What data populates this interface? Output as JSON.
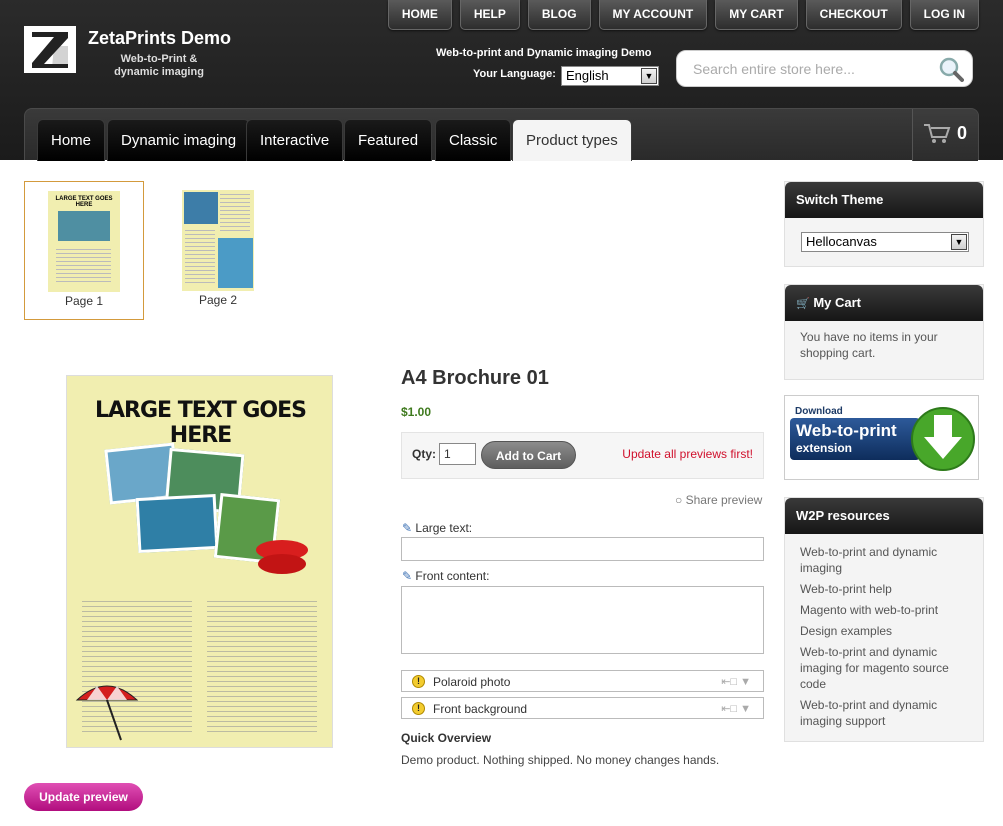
{
  "header": {
    "logo_title": "ZetaPrints Demo",
    "logo_subtitle": "Web-to-Print & dynamic imaging",
    "tagline": "Web-to-print and Dynamic imaging Demo",
    "language_label": "Your Language:",
    "language_value": "English",
    "search_placeholder": "Search entire store here...",
    "top_links": [
      "HOME",
      "HELP",
      "BLOG",
      "MY ACCOUNT",
      "MY CART",
      "CHECKOUT",
      "LOG IN"
    ],
    "tabs": [
      "Home",
      "Dynamic imaging",
      "Interactive",
      "Featured",
      "Classic",
      "Product types"
    ],
    "active_tab": "Product types",
    "cart_count": "0"
  },
  "pages": [
    {
      "label": "Page 1",
      "selected": true
    },
    {
      "label": "Page 2",
      "selected": false
    }
  ],
  "preview": {
    "headline": "LARGE TEXT GOES HERE"
  },
  "product": {
    "title": "A4 Brochure 01",
    "price": "$1.00",
    "qty_label": "Qty:",
    "qty_value": "1",
    "add_to_cart": "Add to Cart",
    "update_note": "Update all previews first!",
    "share": "Share preview",
    "fields": [
      {
        "label": "Large text:",
        "value": ""
      },
      {
        "label": "Front content:",
        "value": ""
      }
    ],
    "images": [
      {
        "label": "Polaroid photo"
      },
      {
        "label": "Front background"
      }
    ],
    "quick_overview_title": "Quick Overview",
    "quick_overview_text": "Demo product. Nothing shipped. No money changes hands.",
    "update_preview": "Update preview"
  },
  "sidebar": {
    "switch_theme_title": "Switch Theme",
    "theme_value": "Hellocanvas",
    "cart_title": "My Cart",
    "cart_text": "You have no items in your shopping cart.",
    "banner_download": "Download",
    "banner_line1": "Web-to-print",
    "banner_line2": "extension",
    "resources_title": "W2P resources",
    "resources": [
      "Web-to-print and dynamic imaging",
      "Web-to-print help",
      "Magento with web-to-print",
      "Design examples",
      "Web-to-print and dynamic imaging for magento source code",
      "Web-to-print and dynamic imaging support"
    ]
  },
  "colors": {
    "price_green": "#3f7a1e",
    "warning_red": "#d0102c",
    "update_button_magenta": "#c8229a",
    "brochure_yellow": "#f1eeb0"
  }
}
